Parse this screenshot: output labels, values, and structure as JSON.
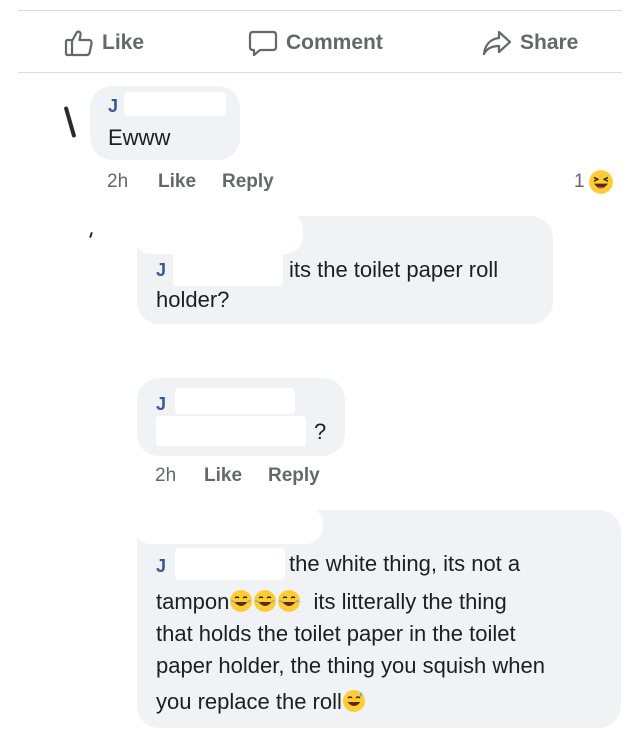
{
  "actions": {
    "like_label": "Like",
    "comment_label": "Comment",
    "share_label": "Share"
  },
  "comments": [
    {
      "name": "J",
      "text": "Ewww",
      "time": "2h",
      "like_label": "Like",
      "reply_label": "Reply",
      "reaction_count": "1"
    },
    {
      "name": "J",
      "text_line1": "its the toilet paper roll",
      "text_line2": "holder?"
    },
    {
      "name": "J",
      "text": "?",
      "time": "2h",
      "like_label": "Like",
      "reply_label": "Reply"
    },
    {
      "name": "J",
      "text_line1": "the white thing, its not a",
      "text_line2_pre": "tampon",
      "text_line2_post": "its litterally the thing",
      "text_line3": "that holds the toilet paper in the toilet",
      "text_line4": "paper holder, the thing you squish when",
      "text_line5": "you replace the roll"
    }
  ],
  "colors": {
    "name_blue": "#385898",
    "muted_gray": "#65676b",
    "bubble_gray": "#f0f2f5",
    "emoji_yellow": "#ffcc33"
  }
}
